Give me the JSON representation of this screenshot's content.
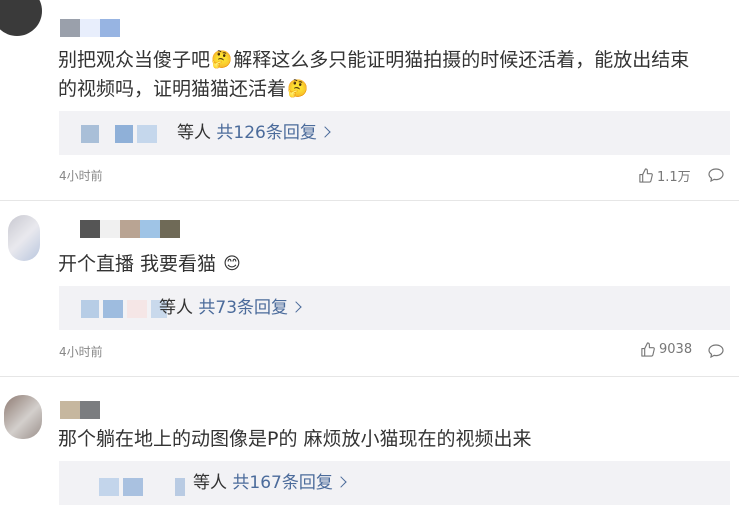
{
  "comments": [
    {
      "body_line1": "别把观众当傻子吧",
      "body_line1b": "解释这么多只能证明猫拍摄的时候还活着，能放出结束",
      "body_line2": "的视频吗，证明猫猫还活着",
      "reply": {
        "who": "等人",
        "count_text": "共126条回复"
      },
      "time": "4小时前",
      "likes": "1.1万"
    },
    {
      "body_line1": "开个直播 我要看猫",
      "reply": {
        "who": "等人",
        "count_text": "共73条回复"
      },
      "time": "4小时前",
      "likes": "9038"
    },
    {
      "body_line1": "那个躺在地上的动图像是P的 麻烦放小猫现在的视频出来",
      "reply": {
        "who": "等人",
        "count_text": "共167条回复"
      }
    }
  ],
  "icons": {
    "emoji_thinking": "thinking-emoji",
    "emoji_smile": "smile-emoji",
    "like": "thumbs-up-icon",
    "comment": "comment-bubble-icon"
  },
  "colors": {
    "link_blue": "#4b6b9b",
    "reply_bg": "#f2f2f5"
  }
}
